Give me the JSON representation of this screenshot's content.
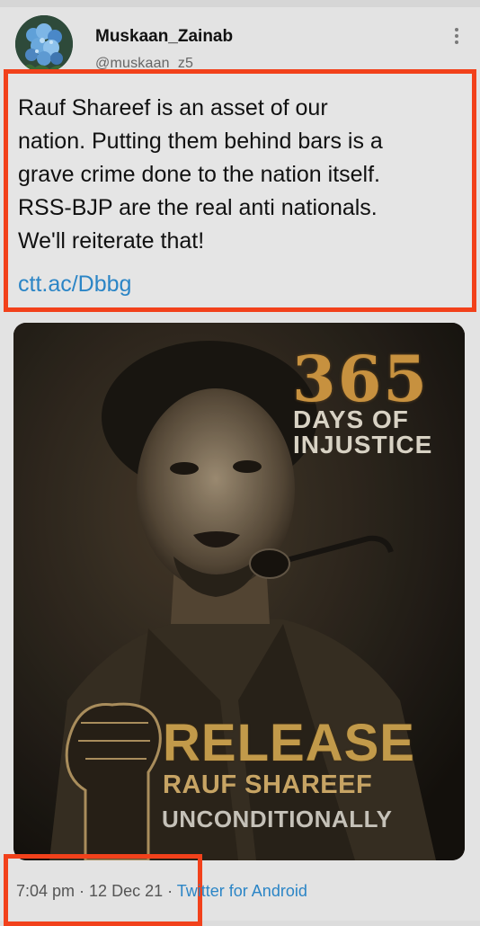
{
  "user": {
    "display_name": "Muskaan_Zainab",
    "handle": "@muskaan_z5"
  },
  "tweet": {
    "text": "Rauf Shareef is an asset of our\nnation.  Putting them behind bars is a\ngrave crime done to the nation itself.\nRSS-BJP are the real anti nationals.\nWe'll reiterate that!",
    "link": "ctt.ac/Dbbg"
  },
  "poster": {
    "number": "365",
    "line1": "DAYS OF",
    "line2": "INJUSTICE",
    "headline": "RELEASE",
    "name": "RAUF SHAREEF",
    "tagline": "UNCONDITIONALLY"
  },
  "meta": {
    "time": "7:04 pm",
    "separator": " · ",
    "date": "12 Dec 21",
    "source": "Twitter for Android"
  },
  "colors": {
    "highlight_border": "#f2411b",
    "link": "#2b85c6"
  }
}
